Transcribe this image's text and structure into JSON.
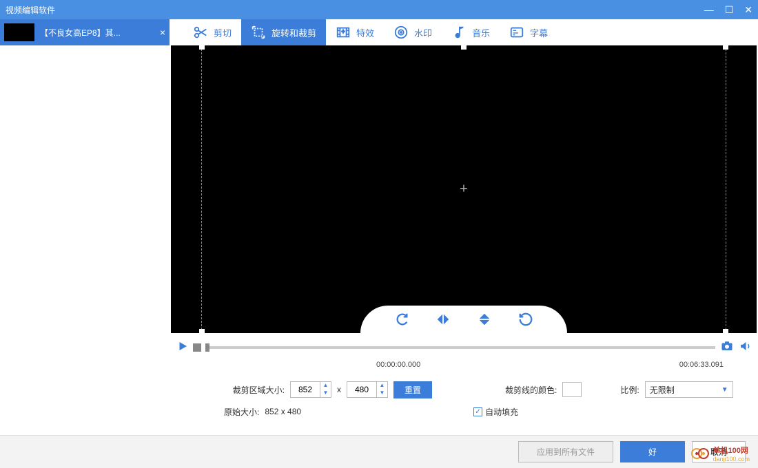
{
  "window": {
    "title": "视频编辑软件"
  },
  "file": {
    "name": "【不良女高EP8】其..."
  },
  "tools": {
    "cut": "剪切",
    "rotate_crop": "旋转和裁剪",
    "effects": "特效",
    "watermark": "水印",
    "music": "音乐",
    "subtitle": "字幕"
  },
  "playback": {
    "current": "00:00:00.000",
    "total": "00:06:33.091"
  },
  "settings": {
    "crop_size_label": "裁剪区域大小:",
    "width": "852",
    "x": "x",
    "height": "480",
    "reset": "重置",
    "crop_color_label": "裁剪线的颜色:",
    "ratio_label": "比例:",
    "ratio_value": "无限制",
    "orig_size_label": "原始大小:",
    "orig_size_value": "852 x 480",
    "auto_fill": "自动填充"
  },
  "footer": {
    "apply_all": "应用到所有文件",
    "ok": "好",
    "cancel": "取消"
  },
  "watermark_site": {
    "name": "单机100网",
    "url": "danji100.com"
  }
}
